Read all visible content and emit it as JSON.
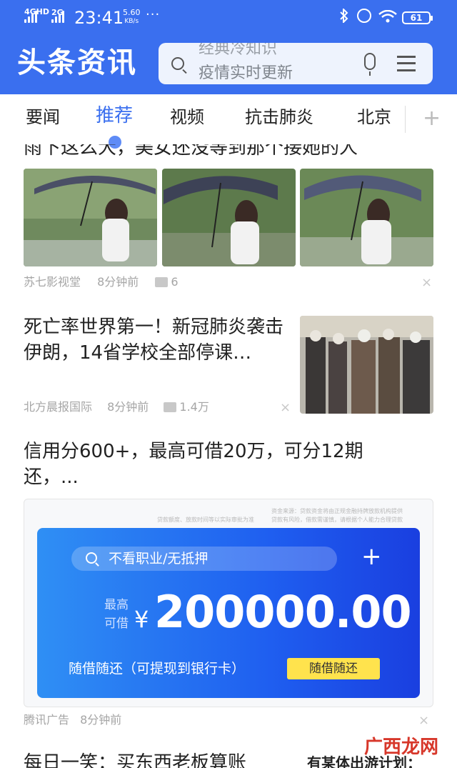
{
  "status_bar": {
    "network": "4GHD 2G",
    "net_a": "4GHD",
    "net_b": "2G",
    "time": "23:41",
    "speed_value": "5.60",
    "speed_unit": "KB/s",
    "dots": "···",
    "battery": "61"
  },
  "header": {
    "brand": "头条资讯",
    "search_hint_top": "经典冷知识",
    "search_hint": "疫情实时更新"
  },
  "tabs": [
    {
      "label": "要闻"
    },
    {
      "label": "推荐",
      "active": true
    },
    {
      "label": "视频"
    },
    {
      "label": "抗击肺炎"
    },
    {
      "label": "北京"
    }
  ],
  "tab_plus": "+",
  "feed": {
    "item1": {
      "title_cut": "雨下这么大，美女还没等到那个接她的人",
      "source": "苏七影视堂",
      "time": "8分钟前",
      "comments": "6"
    },
    "item2": {
      "title": "死亡率世界第一！新冠肺炎袭击伊朗，14省学校全部停课…",
      "source": "北方晨报国际",
      "time": "8分钟前",
      "comments": "1.4万"
    },
    "item3": {
      "title": "信用分600+，最高可借20万，可分12期还，...",
      "ad": {
        "fine_print_1": "资金来源：贷款资金将由正规金融持牌放款机构提供",
        "fine_print_2": "贷款额度、放款时间等以实际审批为准",
        "fine_print_3": "贷款有风险，借款需谨慎，请根据个人能力合理贷款",
        "search_text": "不看职业/无抵押",
        "plus": "+",
        "label_top": "最高",
        "label_bottom": "可借",
        "currency": "¥",
        "amount": "200000.00",
        "note": "随借随还（可提现到银行卡）",
        "button": "随借随还"
      },
      "source": "腾讯广告",
      "time": "8分钟前"
    },
    "item4": {
      "title_cut": "每日一笑：买东西老板算账",
      "title_cut_right": "有某体出游计划："
    }
  },
  "close_glyph": "×",
  "watermark": "广西龙网",
  "colors": {
    "brand_blue": "#3a6fef",
    "ad_yellow": "#ffe34d"
  }
}
